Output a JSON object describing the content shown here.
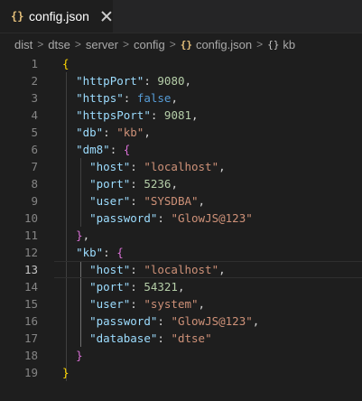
{
  "tab": {
    "title": "config.json",
    "icon": "json-file-icon"
  },
  "breadcrumb": [
    "dist",
    "dtse",
    "server",
    "config",
    "config.json",
    "kb"
  ],
  "lines": [
    {
      "n": "1",
      "tokens": [
        {
          "t": "{",
          "c": "br1"
        }
      ]
    },
    {
      "n": "2",
      "tokens": [
        {
          "t": "  "
        },
        {
          "t": "\"httpPort\"",
          "c": "k"
        },
        {
          "t": ": ",
          "c": "p"
        },
        {
          "t": "9080",
          "c": "n"
        },
        {
          "t": ",",
          "c": "p"
        }
      ]
    },
    {
      "n": "3",
      "tokens": [
        {
          "t": "  "
        },
        {
          "t": "\"https\"",
          "c": "k"
        },
        {
          "t": ": ",
          "c": "p"
        },
        {
          "t": "false",
          "c": "b"
        },
        {
          "t": ",",
          "c": "p"
        }
      ]
    },
    {
      "n": "4",
      "tokens": [
        {
          "t": "  "
        },
        {
          "t": "\"httpsPort\"",
          "c": "k"
        },
        {
          "t": ": ",
          "c": "p"
        },
        {
          "t": "9081",
          "c": "n"
        },
        {
          "t": ",",
          "c": "p"
        }
      ]
    },
    {
      "n": "5",
      "tokens": [
        {
          "t": "  "
        },
        {
          "t": "\"db\"",
          "c": "k"
        },
        {
          "t": ": ",
          "c": "p"
        },
        {
          "t": "\"kb\"",
          "c": "s"
        },
        {
          "t": ",",
          "c": "p"
        }
      ]
    },
    {
      "n": "6",
      "tokens": [
        {
          "t": "  "
        },
        {
          "t": "\"dm8\"",
          "c": "k"
        },
        {
          "t": ": ",
          "c": "p"
        },
        {
          "t": "{",
          "c": "br2"
        }
      ]
    },
    {
      "n": "7",
      "tokens": [
        {
          "t": "    "
        },
        {
          "t": "\"host\"",
          "c": "k"
        },
        {
          "t": ": ",
          "c": "p"
        },
        {
          "t": "\"localhost\"",
          "c": "s"
        },
        {
          "t": ",",
          "c": "p"
        }
      ]
    },
    {
      "n": "8",
      "tokens": [
        {
          "t": "    "
        },
        {
          "t": "\"port\"",
          "c": "k"
        },
        {
          "t": ": ",
          "c": "p"
        },
        {
          "t": "5236",
          "c": "n"
        },
        {
          "t": ",",
          "c": "p"
        }
      ]
    },
    {
      "n": "9",
      "tokens": [
        {
          "t": "    "
        },
        {
          "t": "\"user\"",
          "c": "k"
        },
        {
          "t": ": ",
          "c": "p"
        },
        {
          "t": "\"SYSDBA\"",
          "c": "s"
        },
        {
          "t": ",",
          "c": "p"
        }
      ]
    },
    {
      "n": "10",
      "tokens": [
        {
          "t": "    "
        },
        {
          "t": "\"password\"",
          "c": "k"
        },
        {
          "t": ": ",
          "c": "p"
        },
        {
          "t": "\"GlowJS@123\"",
          "c": "s"
        }
      ]
    },
    {
      "n": "11",
      "tokens": [
        {
          "t": "  "
        },
        {
          "t": "}",
          "c": "br2"
        },
        {
          "t": ",",
          "c": "p"
        }
      ]
    },
    {
      "n": "12",
      "tokens": [
        {
          "t": "  "
        },
        {
          "t": "\"kb\"",
          "c": "k"
        },
        {
          "t": ": ",
          "c": "p"
        },
        {
          "t": "{",
          "c": "br2"
        }
      ]
    },
    {
      "n": "13",
      "tokens": [
        {
          "t": "    "
        },
        {
          "t": "\"host\"",
          "c": "k"
        },
        {
          "t": ": ",
          "c": "p"
        },
        {
          "t": "\"localhost\"",
          "c": "s"
        },
        {
          "t": ",",
          "c": "p"
        }
      ]
    },
    {
      "n": "14",
      "tokens": [
        {
          "t": "    "
        },
        {
          "t": "\"port\"",
          "c": "k"
        },
        {
          "t": ": ",
          "c": "p"
        },
        {
          "t": "54321",
          "c": "n"
        },
        {
          "t": ",",
          "c": "p"
        }
      ]
    },
    {
      "n": "15",
      "tokens": [
        {
          "t": "    "
        },
        {
          "t": "\"user\"",
          "c": "k"
        },
        {
          "t": ": ",
          "c": "p"
        },
        {
          "t": "\"system\"",
          "c": "s"
        },
        {
          "t": ",",
          "c": "p"
        }
      ]
    },
    {
      "n": "16",
      "tokens": [
        {
          "t": "    "
        },
        {
          "t": "\"password\"",
          "c": "k"
        },
        {
          "t": ": ",
          "c": "p"
        },
        {
          "t": "\"GlowJS@123\"",
          "c": "s"
        },
        {
          "t": ",",
          "c": "p"
        }
      ]
    },
    {
      "n": "17",
      "tokens": [
        {
          "t": "    "
        },
        {
          "t": "\"database\"",
          "c": "k"
        },
        {
          "t": ": ",
          "c": "p"
        },
        {
          "t": "\"dtse\"",
          "c": "s"
        }
      ]
    },
    {
      "n": "18",
      "tokens": [
        {
          "t": "  "
        },
        {
          "t": "}",
          "c": "br2"
        }
      ]
    },
    {
      "n": "19",
      "tokens": [
        {
          "t": "}",
          "c": "br1"
        }
      ]
    }
  ],
  "current_line": "13",
  "colors": {
    "background": "#1e1e1e",
    "key": "#9cdcfe",
    "string": "#ce9178",
    "number": "#b5cea8",
    "boolean": "#569cd6",
    "bracket_level1": "#ffd700",
    "bracket_level2": "#da70d6"
  }
}
